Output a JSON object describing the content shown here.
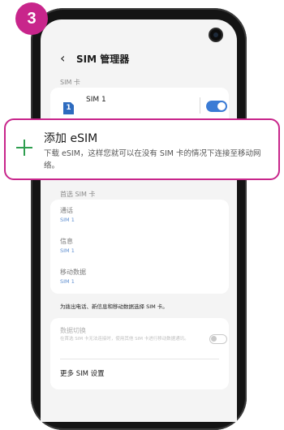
{
  "step": {
    "number": "3"
  },
  "header": {
    "back_glyph": "‹",
    "title": "SIM 管理器"
  },
  "sim_section": {
    "label": "SIM 卡",
    "sim1": {
      "icon_text": "1",
      "label": "SIM 1",
      "enabled": true
    }
  },
  "callout": {
    "title": "添加 eSIM",
    "description": "下载 eSIM，这样您就可以在没有 SIM 卡的情况下连接至移动网络。",
    "border_color": "#c8258b",
    "plus_color": "#2e9e4f"
  },
  "preferred": {
    "label": "首选 SIM 卡",
    "items": [
      {
        "title": "通话",
        "value": "SIM 1"
      },
      {
        "title": "信息",
        "value": "SIM 1"
      },
      {
        "title": "移动数据",
        "value": "SIM 1"
      }
    ]
  },
  "note": "为拨出电话、新信息和移动数据选择 SIM 卡。",
  "data_switch": {
    "title": "数据切换",
    "description": "在首选 SIM 卡无法连接时，使用其他 SIM 卡进行移动数据通讯。",
    "enabled": false
  },
  "more": {
    "label": "更多 SIM 设置"
  },
  "colors": {
    "accent": "#3a7bd5",
    "step_badge": "#c8258b"
  }
}
